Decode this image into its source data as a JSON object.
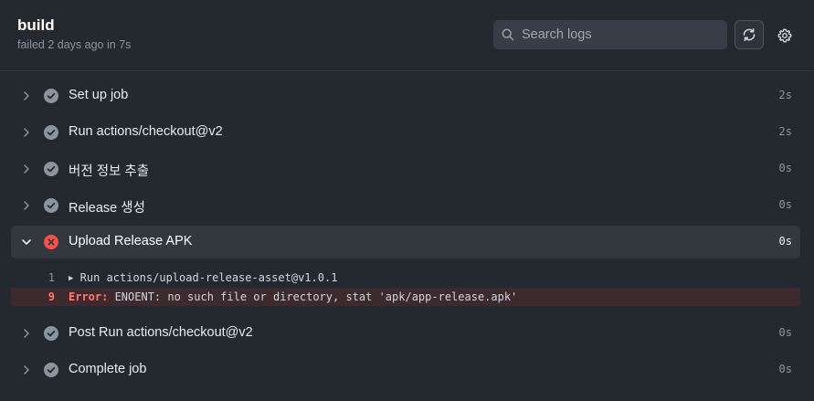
{
  "job": {
    "title": "build",
    "meta": "failed 2 days ago in 7s"
  },
  "search": {
    "placeholder": "Search logs",
    "value": ""
  },
  "steps": [
    {
      "name": "Set up job",
      "duration": "2s",
      "status": "success"
    },
    {
      "name": "Run actions/checkout@v2",
      "duration": "2s",
      "status": "success"
    },
    {
      "name": "버전 정보 추출",
      "duration": "0s",
      "status": "success"
    },
    {
      "name": "Release 생성",
      "duration": "0s",
      "status": "success"
    },
    {
      "name": "Upload Release APK",
      "duration": "0s",
      "status": "failure",
      "expanded": true
    },
    {
      "name": "Post Run actions/checkout@v2",
      "duration": "0s",
      "status": "success"
    },
    {
      "name": "Complete job",
      "duration": "0s",
      "status": "success"
    }
  ],
  "logs": [
    {
      "line": "1",
      "text": "Run actions/upload-release-asset@v1.0.1",
      "collapsed_group": true
    },
    {
      "line": "9",
      "label": "Error:",
      "text": " ENOENT: no such file or directory, stat 'apk/app-release.apk'",
      "error": true
    }
  ],
  "colors": {
    "background": "#24292f",
    "success_icon": "#8c959f",
    "failure_icon": "#f85149",
    "error_row": "#3c2a2e"
  },
  "icons": {
    "search": "search-icon",
    "refresh": "sync-icon",
    "settings": "gear-icon",
    "success": "check-circle-icon",
    "failure": "x-circle-icon",
    "collapsed": "chevron-right-icon",
    "expanded": "chevron-down-icon"
  }
}
